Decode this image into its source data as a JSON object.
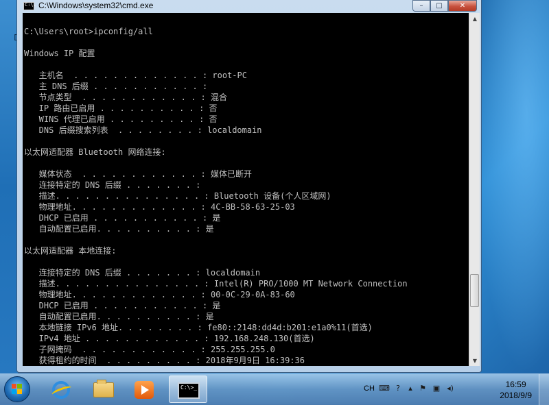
{
  "desktop": {
    "side_letter": "D"
  },
  "window": {
    "title": "C:\\Windows\\system32\\cmd.exe",
    "icon_text": "C:\\.",
    "buttons": {
      "minimize": "–",
      "maximize": "□",
      "close": "✕"
    }
  },
  "console": {
    "lines": [
      "C:\\Users\\root>ipconfig/all",
      "Windows IP 配置",
      "   主机名  . . . . . . . . . . . . . : root-PC",
      "   主 DNS 后缀 . . . . . . . . . . . :",
      "   节点类型  . . . . . . . . . . . . : 混合",
      "   IP 路由已启用 . . . . . . . . . . : 否",
      "   WINS 代理已启用 . . . . . . . . . : 否",
      "   DNS 后缀搜索列表  . . . . . . . . : localdomain",
      "以太网适配器 Bluetooth 网络连接:",
      "   媒体状态  . . . . . . . . . . . . : 媒体已断开",
      "   连接特定的 DNS 后缀 . . . . . . . :",
      "   描述. . . . . . . . . . . . . . . : Bluetooth 设备(个人区域网)",
      "   物理地址. . . . . . . . . . . . . : 4C-BB-58-63-25-03",
      "   DHCP 已启用 . . . . . . . . . . . : 是",
      "   自动配置已启用. . . . . . . . . . : 是",
      "以太网适配器 本地连接:",
      "   连接特定的 DNS 后缀 . . . . . . . : localdomain",
      "   描述. . . . . . . . . . . . . . . : Intel(R) PRO/1000 MT Network Connection",
      "   物理地址. . . . . . . . . . . . . : 00-0C-29-0A-83-60",
      "   DHCP 已启用 . . . . . . . . . . . : 是",
      "   自动配置已启用. . . . . . . . . . : 是",
      "   本地链接 IPv6 地址. . . . . . . . : fe80::2148:dd4d:b201:e1a0%11(首选)",
      "   IPv4 地址 . . . . . . . . . . . . : 192.168.248.130(首选)",
      "   子网掩码  . . . . . . . . . . . . : 255.255.255.0",
      "   获得租约的时间  . . . . . . . . . : 2018年9月9日 16:39:36"
    ]
  },
  "scrollbar": {
    "up_arrow": "▲",
    "down_arrow": "▼"
  },
  "taskbar": {
    "cmd_icon_text": "C:\\>_",
    "tray": {
      "language": "CH",
      "time": "16:59",
      "date": "2018/9/9",
      "icons": [
        "keyboard-icon",
        "help-icon",
        "show-hidden-icon",
        "flag-icon",
        "network-icon",
        "volume-icon"
      ]
    }
  }
}
